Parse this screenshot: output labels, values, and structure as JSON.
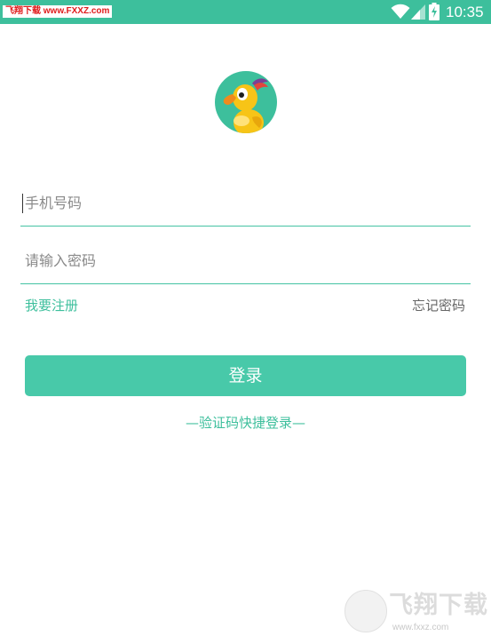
{
  "status_bar": {
    "watermark": "飞翔下载 www.FXXZ.com",
    "time": "10:35",
    "icons": [
      "wifi-icon",
      "signal-icon",
      "battery-charging-icon"
    ],
    "color": "#3dbf9c"
  },
  "logo": {
    "icon": "cartoon-bird-avatar-icon"
  },
  "form": {
    "phone_placeholder": "手机号码",
    "password_placeholder": "请输入密码"
  },
  "links": {
    "register": "我要注册",
    "forgot_password": "忘记密码"
  },
  "login_button": {
    "label": "登录",
    "color": "#48c9a9"
  },
  "sms_login": {
    "label": "—验证码快捷登录—"
  },
  "watermark_bottom": {
    "text": "飞翔下载",
    "url": "www.fxxz.com"
  }
}
